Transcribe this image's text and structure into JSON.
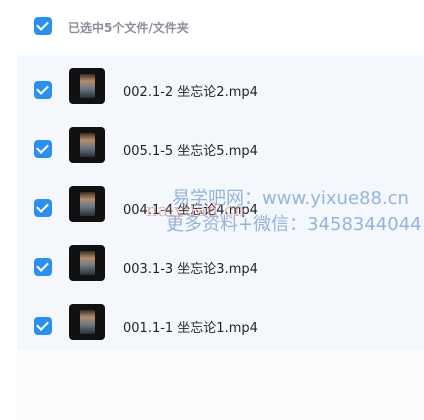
{
  "header": {
    "selection_label": "已选中5个文件/文件夹"
  },
  "files": [
    {
      "name": "002.1-2 坐忘论2.mp4"
    },
    {
      "name": "005.1-5 坐忘论5.mp4"
    },
    {
      "name": "004.1-4 坐忘论4.mp4"
    },
    {
      "name": "003.1-3 坐忘论3.mp4"
    },
    {
      "name": "001.1-1 坐忘论1.mp4"
    }
  ],
  "watermark": {
    "line1": "易学吧网：www.yixue88.cn",
    "line2": "更多资料+微信：3458344044",
    "line3": "naiyuad.cn"
  },
  "colors": {
    "accent": "#2b8ff0",
    "list_bg": "#f4f8fc"
  }
}
